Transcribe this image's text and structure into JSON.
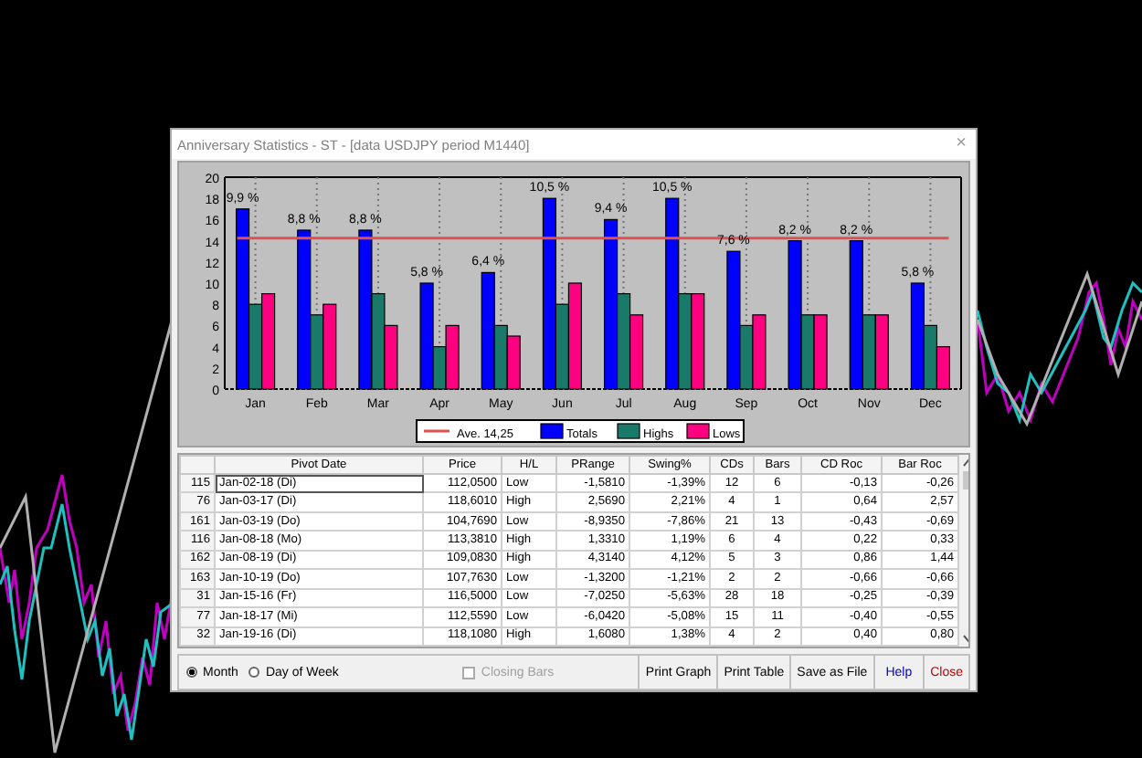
{
  "window": {
    "title": "Anniversary Statistics - ST - [data USDJPY period M1440]",
    "close": "×"
  },
  "graph": {
    "chart_data": {
      "type": "bar",
      "categories": [
        "Jan",
        "Feb",
        "Mar",
        "Apr",
        "May",
        "Jun",
        "Jul",
        "Aug",
        "Sep",
        "Oct",
        "Nov",
        "Dec"
      ],
      "series": [
        {
          "name": "Totals",
          "color": "#0000ff",
          "values": [
            17,
            15,
            15,
            10,
            11,
            18,
            16,
            18,
            13,
            14,
            14,
            10
          ]
        },
        {
          "name": "Highs",
          "color": "#1a7a6a",
          "values": [
            8,
            7,
            9,
            4,
            6,
            8,
            9,
            9,
            6,
            7,
            7,
            6
          ]
        },
        {
          "name": "Lows",
          "color": "#ff0080",
          "values": [
            9,
            8,
            6,
            6,
            5,
            10,
            7,
            9,
            7,
            7,
            7,
            4
          ]
        }
      ],
      "ylim": [
        0,
        20
      ],
      "yticks": [
        0,
        2,
        4,
        6,
        8,
        10,
        12,
        14,
        16,
        18,
        20
      ],
      "value_labels": [
        "9,9 %",
        "8,8 %",
        "8,8 %",
        "5,8 %",
        "6,4 %",
        "10,5 %",
        "9,4 %",
        "10,5 %",
        "7,6 %",
        "8,2 %",
        "8,2 %",
        "5,8 %"
      ],
      "ref_lines": [
        {
          "axis": "y",
          "value": 14.25,
          "label": "Ave. 14,25",
          "color": "#e05050"
        }
      ],
      "grid": true,
      "legend": "bottom"
    }
  },
  "table": {
    "columns": [
      "",
      "Pivot Date",
      "Price",
      "H/L",
      "PRange",
      "Swing%",
      "CDs",
      "Bars",
      "CD Roc",
      "Bar Roc"
    ],
    "rows": [
      {
        "cells": [
          "115",
          "Jan-02-18 (Di)",
          "112,0500",
          "Low",
          "-1,5810",
          "-1,39%",
          "12",
          "6",
          "-0,13",
          "-0,26"
        ],
        "focused": true
      },
      {
        "cells": [
          "76",
          "Jan-03-17 (Di)",
          "118,6010",
          "High",
          "2,5690",
          "2,21%",
          "4",
          "1",
          "0,64",
          "2,57"
        ],
        "focused": false
      },
      {
        "cells": [
          "161",
          "Jan-03-19 (Do)",
          "104,7690",
          "Low",
          "-8,9350",
          "-7,86%",
          "21",
          "13",
          "-0,43",
          "-0,69"
        ],
        "focused": false
      },
      {
        "cells": [
          "116",
          "Jan-08-18 (Mo)",
          "113,3810",
          "High",
          "1,3310",
          "1,19%",
          "6",
          "4",
          "0,22",
          "0,33"
        ],
        "focused": false
      },
      {
        "cells": [
          "162",
          "Jan-08-19 (Di)",
          "109,0830",
          "High",
          "4,3140",
          "4,12%",
          "5",
          "3",
          "0,86",
          "1,44"
        ],
        "focused": false
      },
      {
        "cells": [
          "163",
          "Jan-10-19 (Do)",
          "107,7630",
          "Low",
          "-1,3200",
          "-1,21%",
          "2",
          "2",
          "-0,66",
          "-0,66"
        ],
        "focused": false
      },
      {
        "cells": [
          "31",
          "Jan-15-16 (Fr)",
          "116,5000",
          "Low",
          "-7,0250",
          "-5,63%",
          "28",
          "18",
          "-0,25",
          "-0,39"
        ],
        "focused": false
      },
      {
        "cells": [
          "77",
          "Jan-18-17 (Mi)",
          "112,5590",
          "Low",
          "-6,0420",
          "-5,08%",
          "15",
          "11",
          "-0,40",
          "-0,55"
        ],
        "focused": false
      },
      {
        "cells": [
          "32",
          "Jan-19-16 (Di)",
          "118,1080",
          "High",
          "1,6080",
          "1,38%",
          "4",
          "2",
          "0,40",
          "0,80"
        ],
        "focused": false
      }
    ]
  },
  "options": {
    "radios": [
      {
        "label": "Month",
        "selected": true
      },
      {
        "label": "Day of Week",
        "selected": false
      }
    ],
    "checkbox": {
      "label": "Closing Bars",
      "checked": false,
      "disabled": true
    }
  },
  "buttons": [
    {
      "label": "Print Graph",
      "kind": "normal"
    },
    {
      "label": "Print Table",
      "kind": "normal"
    },
    {
      "label": "Save as File",
      "kind": "normal"
    },
    {
      "label": "Help",
      "kind": "help"
    },
    {
      "label": "Close",
      "kind": "close"
    }
  ]
}
